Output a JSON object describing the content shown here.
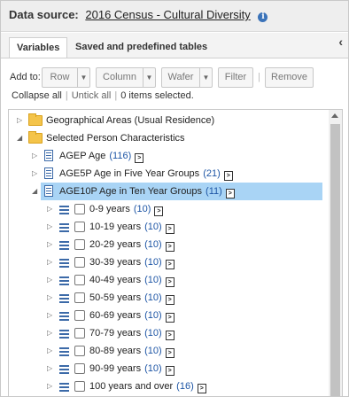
{
  "header": {
    "label": "Data source:",
    "source_link": "2016 Census - Cultural Diversity",
    "info_icon": "info-icon"
  },
  "tabs": [
    {
      "label": "Variables",
      "active": true
    },
    {
      "label": "Saved and predefined tables",
      "active": false
    }
  ],
  "toolbar": {
    "add_to_label": "Add to:",
    "row": "Row",
    "column": "Column",
    "wafer": "Wafer",
    "filter": "Filter",
    "remove": "Remove"
  },
  "selection": {
    "collapse_all": "Collapse all",
    "untick_all": "Untick all",
    "status": "0 items selected."
  },
  "tree": {
    "geo": {
      "label": "Geographical Areas (Usual Residence)"
    },
    "person": {
      "label": "Selected Person Characteristics"
    },
    "agep": {
      "label": "AGEP Age",
      "count": "(116)"
    },
    "age5p": {
      "label": "AGE5P Age in Five Year Groups",
      "count": "(21)"
    },
    "age10p": {
      "label": "AGE10P Age in Ten Year Groups",
      "count": "(11)"
    },
    "groups": [
      {
        "label": "0-9 years",
        "count": "(10)"
      },
      {
        "label": "10-19 years",
        "count": "(10)"
      },
      {
        "label": "20-29 years",
        "count": "(10)"
      },
      {
        "label": "30-39 years",
        "count": "(10)"
      },
      {
        "label": "40-49 years",
        "count": "(10)"
      },
      {
        "label": "50-59 years",
        "count": "(10)"
      },
      {
        "label": "60-69 years",
        "count": "(10)"
      },
      {
        "label": "70-79 years",
        "count": "(10)"
      },
      {
        "label": "80-89 years",
        "count": "(10)"
      },
      {
        "label": "90-99 years",
        "count": "(10)"
      },
      {
        "label": "100 years and over",
        "count": "(16)"
      }
    ]
  },
  "colors": {
    "selected_row": "#a9d4f5",
    "count_text": "#1d55a5",
    "folder": "#f4c44a"
  }
}
